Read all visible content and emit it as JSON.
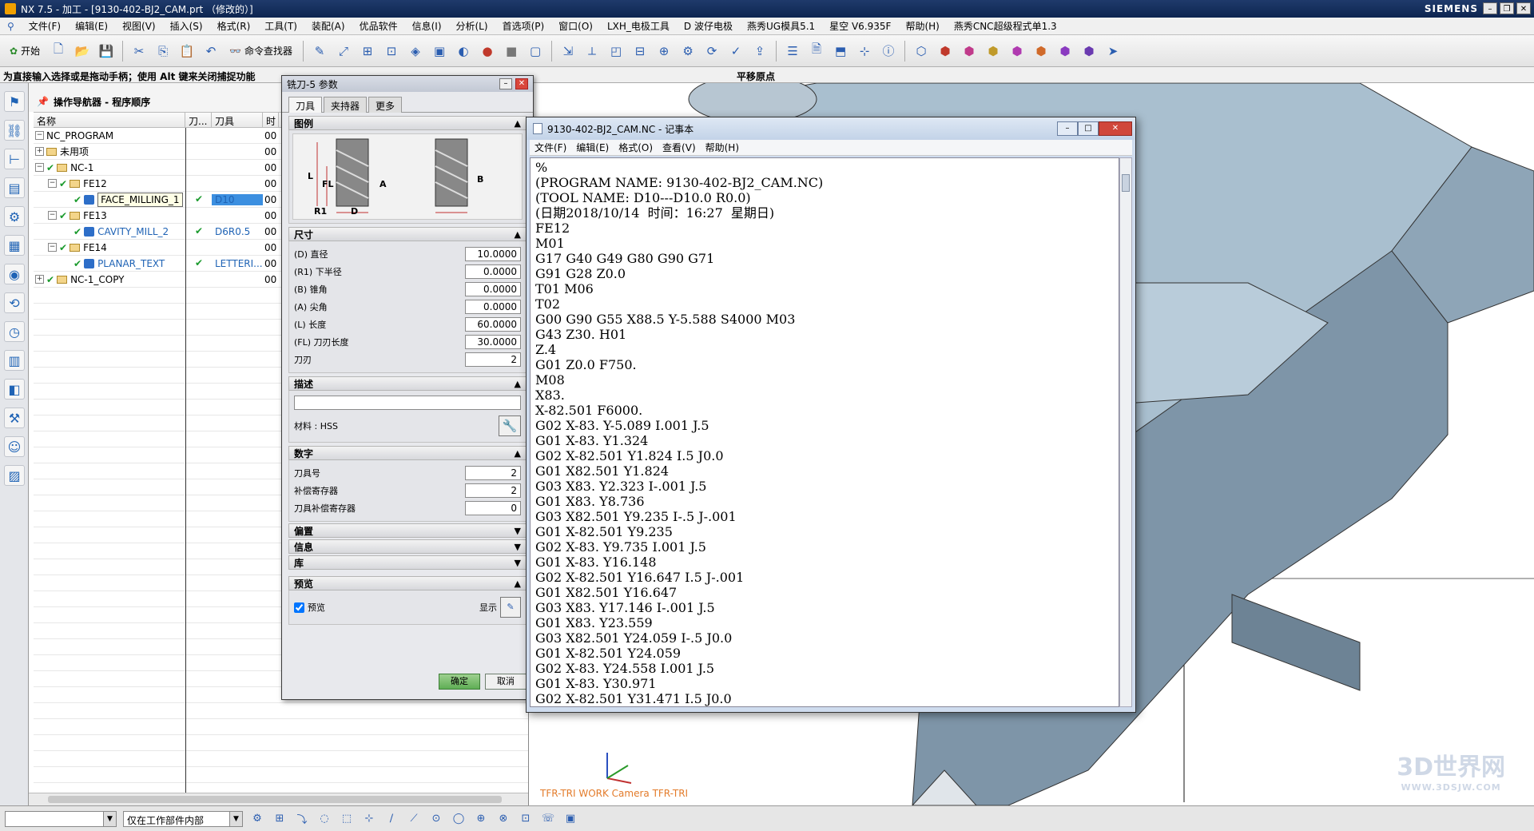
{
  "window": {
    "title": "NX 7.5 - 加工 - [9130-402-BJ2_CAM.prt （修改的）]",
    "brand": "SIEMENS"
  },
  "menu": [
    "文件(F)",
    "编辑(E)",
    "视图(V)",
    "插入(S)",
    "格式(R)",
    "工具(T)",
    "装配(A)",
    "优品软件",
    "信息(I)",
    "分析(L)",
    "首选项(P)",
    "窗口(O)",
    "LXH_电极工具",
    "D 波仔电极",
    "燕秀UG模具5.1",
    "星空 V6.935F",
    "帮助(H)",
    "燕秀CNC超级程式单1.3"
  ],
  "toolbar": {
    "start_label": "开始",
    "command_finder_label": "命令查找器"
  },
  "hint": {
    "text": "为直接输入选择或是拖动手柄；使用 Alt 键来关闭捕捉功能",
    "status": "平移原点"
  },
  "navigator": {
    "title": "操作导航器 - 程序顺序",
    "columns": [
      "名称",
      "刀...",
      "刀具",
      "时"
    ],
    "rows": [
      {
        "name": "NC_PROGRAM",
        "tool": "",
        "time": "00",
        "check": "",
        "level": 0
      },
      {
        "name": "未用项",
        "tool": "",
        "time": "00",
        "check": "",
        "level": 0
      },
      {
        "name": "NC-1",
        "tool": "",
        "time": "00",
        "check": "✔",
        "level": 0
      },
      {
        "name": "FE12",
        "tool": "",
        "time": "00",
        "check": "✔",
        "level": 1
      },
      {
        "name": "FACE_MILLING_1",
        "tool": "D10",
        "time": "00",
        "check": "✔",
        "level": 2
      },
      {
        "name": "FE13",
        "tool": "",
        "time": "00",
        "check": "✔",
        "level": 1
      },
      {
        "name": "CAVITY_MILL_2",
        "tool": "D6R0.5",
        "time": "00",
        "check": "✔",
        "level": 2
      },
      {
        "name": "FE14",
        "tool": "",
        "time": "00",
        "check": "✔",
        "level": 1
      },
      {
        "name": "PLANAR_TEXT",
        "tool": "LETTERI...",
        "time": "00",
        "check": "✔",
        "level": 2
      },
      {
        "name": "NC-1_COPY",
        "tool": "",
        "time": "00",
        "check": "✔",
        "level": 0
      }
    ]
  },
  "dialog": {
    "title": "铣刀-5 参数",
    "tabs": [
      "刀具",
      "夹持器",
      "更多"
    ],
    "sections": {
      "legend": "图例",
      "dimensions": "尺寸",
      "description": "描述",
      "numbers": "数字",
      "offset": "偏置",
      "info": "信息",
      "library": "库",
      "preview": "预览"
    },
    "legend_labels": {
      "L": "L",
      "FL": "FL",
      "A": "A",
      "R1": "R1",
      "D": "D",
      "B": "B"
    },
    "dims": [
      {
        "label": "(D) 直径",
        "value": "10.0000"
      },
      {
        "label": "(R1) 下半径",
        "value": "0.0000"
      },
      {
        "label": "(B) 锥角",
        "value": "0.0000"
      },
      {
        "label": "(A) 尖角",
        "value": "0.0000"
      },
      {
        "label": "(L) 长度",
        "value": "60.0000"
      },
      {
        "label": "(FL) 刀刃长度",
        "value": "30.0000"
      },
      {
        "label": "刀刃",
        "value": "2"
      }
    ],
    "material": "材料 : HSS",
    "nums": [
      {
        "label": "刀具号",
        "value": "2"
      },
      {
        "label": "补偿寄存器",
        "value": "2"
      },
      {
        "label": "刀具补偿寄存器",
        "value": "0"
      }
    ],
    "preview_check": "预览",
    "show_label": "显示",
    "ok": "确定",
    "cancel": "取消"
  },
  "notepad": {
    "title": "9130-402-BJ2_CAM.NC - 记事本",
    "menu": [
      "文件(F)",
      "编辑(E)",
      "格式(O)",
      "查看(V)",
      "帮助(H)"
    ],
    "lines": [
      "%",
      "(PROGRAM NAME: 9130-402-BJ2_CAM.NC)",
      "(TOOL NAME: D10---D10.0 R0.0)",
      "(日期2018/10/14  时间：16:27  星期日)",
      "FE12",
      "M01",
      "G17 G40 G49 G80 G90 G71",
      "G91 G28 Z0.0",
      "T01 M06",
      "T02",
      "G00 G90 G55 X88.5 Y-5.588 S4000 M03",
      "G43 Z30. H01",
      "Z.4",
      "G01 Z0.0 F750.",
      "M08",
      "X83.",
      "X-82.501 F6000.",
      "G02 X-83. Y-5.089 I.001 J.5",
      "G01 X-83. Y1.324",
      "G02 X-82.501 Y1.824 I.5 J0.0",
      "G01 X82.501 Y1.824",
      "G03 X83. Y2.323 I-.001 J.5",
      "G01 X83. Y8.736",
      "G03 X82.501 Y9.235 I-.5 J-.001",
      "G01 X-82.501 Y9.235",
      "G02 X-83. Y9.735 I.001 J.5",
      "G01 X-83. Y16.148",
      "G02 X-82.501 Y16.647 I.5 J-.001",
      "G01 X82.501 Y16.647",
      "G03 X83. Y17.146 I-.001 J.5",
      "G01 X83. Y23.559",
      "G03 X82.501 Y24.059 I-.5 J0.0",
      "G01 X-82.501 Y24.059",
      "G02 X-83. Y24.558 I.001 J.5",
      "G01 X-83. Y30.971",
      "G02 X-82.501 Y31.471 I.5 J0.0"
    ]
  },
  "viewport": {
    "label": "TFR-TRI WORK Camera TFR-TRI",
    "watermark": "3D世界网",
    "watermark_url": "WWW.3DSJW.COM"
  },
  "bottom": {
    "filter_value": "",
    "scope_value": "仅在工作部件内部"
  },
  "colors": {
    "accent": "#3c8fe0",
    "check": "#1a9a2c",
    "part": "#a9bfcf"
  }
}
